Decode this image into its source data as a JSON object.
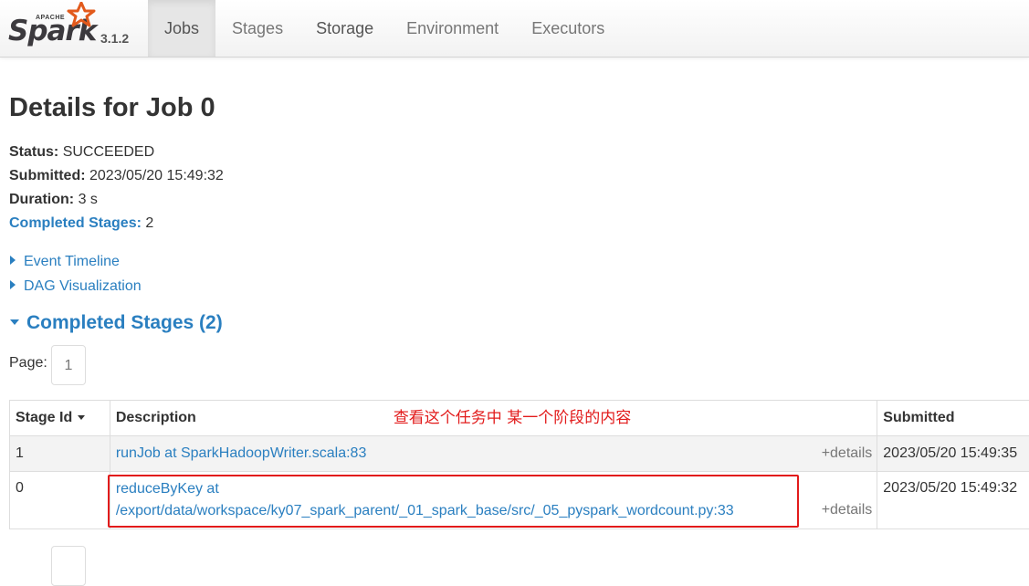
{
  "brand": {
    "apache_label": "APACHE",
    "name": "Spark",
    "version": "3.1.2",
    "star_color": "#e25a1c"
  },
  "nav": {
    "tabs": [
      {
        "label": "Jobs",
        "active": true
      },
      {
        "label": "Stages",
        "active": false
      },
      {
        "label": "Storage",
        "active": false
      },
      {
        "label": "Environment",
        "active": false
      },
      {
        "label": "Executors",
        "active": false
      }
    ]
  },
  "page": {
    "title": "Details for Job 0"
  },
  "summary": {
    "status_label": "Status:",
    "status_value": "SUCCEEDED",
    "submitted_label": "Submitted:",
    "submitted_value": "2023/05/20 15:49:32",
    "duration_label": "Duration:",
    "duration_value": "3 s",
    "completed_stages_label": "Completed Stages:",
    "completed_stages_value": "2"
  },
  "toggles": {
    "event_timeline": "Event Timeline",
    "dag_visualization": "DAG Visualization"
  },
  "section": {
    "completed_stages_header": "Completed Stages (2)"
  },
  "pagination": {
    "label": "Page:",
    "current": "1"
  },
  "table": {
    "headers": {
      "stage_id": "Stage Id",
      "description": "Description",
      "submitted": "Submitted"
    },
    "annotation": "查看这个任务中 某一个阶段的内容",
    "rows": [
      {
        "stage_id": "1",
        "description": "runJob at SparkHadoopWriter.scala:83",
        "details": "+details",
        "submitted": "2023/05/20 15:49:35"
      },
      {
        "stage_id": "0",
        "description_line1": "reduceByKey at",
        "description_line2": "/export/data/workspace/ky07_spark_parent/_01_spark_base/src/_05_pyspark_wordcount.py:33",
        "details": "+details",
        "submitted": "2023/05/20 15:49:32"
      }
    ]
  },
  "colors": {
    "link": "#2a7fc0",
    "annotation": "#e21b1b"
  }
}
